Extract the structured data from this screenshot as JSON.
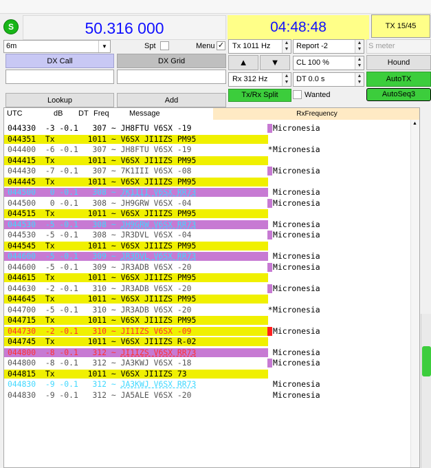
{
  "toolbar": {
    "band_menu_icon": "S"
  },
  "header": {
    "frequency": "50.316 000",
    "clock": "04:48:48",
    "tx_counter": "TX 15/45"
  },
  "controls": {
    "band": "6m",
    "spot_label": "Spt",
    "menu_label": "Menu",
    "tx_freq": "Tx  1011  Hz",
    "rx_freq": "Rx  312  Hz",
    "report": "Report -2",
    "s_meter_placeholder": "S meter",
    "cl": "CL  100 %",
    "dt": "DT 0.0 s",
    "dx_call_label": "DX Call",
    "dx_grid_label": "DX Grid",
    "lookup_label": "Lookup",
    "add_label": "Add",
    "txrx_split_label": "Tx/Rx Split",
    "wanted_label": "Wanted",
    "hound_label": "Hound",
    "autotx_label": "AutoTX",
    "autoseq_label": "AutoSeq3",
    "up_arrow": "▲",
    "down_arrow": "▼"
  },
  "decode_header": {
    "utc": "UTC",
    "db": "dB",
    "dt": "DT",
    "freq": "Freq",
    "message": "Message",
    "rx_frequency": "RxFrequency"
  },
  "colors": {
    "tx_yellow": "#f0f000",
    "cq_magenta": "#c77ad3",
    "mine_red": "#ff2020",
    "cyan_text": "#40d8ff",
    "red_text": "#ff3030",
    "autotx_green": "#3ccd3c"
  },
  "decodes": [
    {
      "utc": "044330",
      "db": "-3",
      "dt": "-0.1",
      "freq": "307",
      "sep": "~",
      "msg": "JH8FTU V6SX -19",
      "country": "Micronesia",
      "style": "normal",
      "mark": "magenta"
    },
    {
      "utc": "044351",
      "db": "Tx",
      "dt": "",
      "freq": "1011",
      "sep": "~",
      "msg": "V6SX JI1IZS PM95",
      "country": "",
      "style": "tx"
    },
    {
      "utc": "044400",
      "db": "-6",
      "dt": "-0.1",
      "freq": "307",
      "sep": "~",
      "msg": "JH8FTU V6SX -19",
      "country": "Micronesia",
      "style": "gray",
      "mark": "star"
    },
    {
      "utc": "044415",
      "db": "Tx",
      "dt": "",
      "freq": "1011",
      "sep": "~",
      "msg": "V6SX JI1IZS PM95",
      "country": "",
      "style": "tx"
    },
    {
      "utc": "044430",
      "db": "-7",
      "dt": "-0.1",
      "freq": "307",
      "sep": "~",
      "msg": "7K1III V6SX -08",
      "country": "Micronesia",
      "style": "gray",
      "mark": "magenta"
    },
    {
      "utc": "044445",
      "db": "Tx",
      "dt": "",
      "freq": "1011",
      "sep": "~",
      "msg": "V6SX JI1IZS PM95",
      "country": "",
      "style": "tx"
    },
    {
      "utc": "044500",
      "db": "0",
      "dt": "-0.1",
      "freq": "308",
      "sep": "~",
      "msg": "7K1III V6SX RR73",
      "country": "Micronesia",
      "style": "cq"
    },
    {
      "utc": "044500",
      "db": "0",
      "dt": "-0.1",
      "freq": "308",
      "sep": "~",
      "msg": "JH9GRW V6SX -04",
      "country": "Micronesia",
      "style": "gray",
      "mark": "magenta"
    },
    {
      "utc": "044515",
      "db": "Tx",
      "dt": "",
      "freq": "1011",
      "sep": "~",
      "msg": "V6SX JI1IZS PM95",
      "country": "",
      "style": "tx"
    },
    {
      "utc": "044530",
      "db": "-5",
      "dt": "-0.1",
      "freq": "308",
      "sep": "~",
      "msg": "JH9GRW V6SX RR73",
      "country": "Micronesia",
      "style": "cq"
    },
    {
      "utc": "044530",
      "db": "-5",
      "dt": "-0.1",
      "freq": "308",
      "sep": "~",
      "msg": "JR3DVL V6SX -04",
      "country": "Micronesia",
      "style": "gray",
      "mark": "magenta"
    },
    {
      "utc": "044545",
      "db": "Tx",
      "dt": "",
      "freq": "1011",
      "sep": "~",
      "msg": "V6SX JI1IZS PM95",
      "country": "",
      "style": "tx"
    },
    {
      "utc": "044600",
      "db": "-5",
      "dt": "-0.1",
      "freq": "309",
      "sep": "~",
      "msg": "JR3DVL V6SX RR73",
      "country": "Micronesia",
      "style": "cq"
    },
    {
      "utc": "044600",
      "db": "-5",
      "dt": "-0.1",
      "freq": "309",
      "sep": "~",
      "msg": "JR3ADB V6SX -20",
      "country": "Micronesia",
      "style": "gray",
      "mark": "magenta"
    },
    {
      "utc": "044615",
      "db": "Tx",
      "dt": "",
      "freq": "1011",
      "sep": "~",
      "msg": "V6SX JI1IZS PM95",
      "country": "",
      "style": "tx"
    },
    {
      "utc": "044630",
      "db": "-2",
      "dt": "-0.1",
      "freq": "310",
      "sep": "~",
      "msg": "JR3ADB V6SX -20",
      "country": "Micronesia",
      "style": "gray",
      "mark": "magenta"
    },
    {
      "utc": "044645",
      "db": "Tx",
      "dt": "",
      "freq": "1011",
      "sep": "~",
      "msg": "V6SX JI1IZS PM95",
      "country": "",
      "style": "tx"
    },
    {
      "utc": "044700",
      "db": "-5",
      "dt": "-0.1",
      "freq": "310",
      "sep": "~",
      "msg": "JR3ADB V6SX -20",
      "country": "Micronesia",
      "style": "gray",
      "mark": "star"
    },
    {
      "utc": "044715",
      "db": "Tx",
      "dt": "",
      "freq": "1011",
      "sep": "~",
      "msg": "V6SX JI1IZS PM95",
      "country": "",
      "style": "tx"
    },
    {
      "utc": "044730",
      "db": "-2",
      "dt": "-0.1",
      "freq": "310",
      "sep": "~",
      "msg": "JI1IZS V6SX -09",
      "country": "Micronesia",
      "style": "mine",
      "mark": "red"
    },
    {
      "utc": "044745",
      "db": "Tx",
      "dt": "",
      "freq": "1011",
      "sep": "~",
      "msg": "V6SX JI1IZS R-02",
      "country": "",
      "style": "tx"
    },
    {
      "utc": "044800",
      "db": "-8",
      "dt": "-0.1",
      "freq": "312",
      "sep": "~",
      "msg": "JI1IZS V6SX RR73",
      "country": "Micronesia",
      "style": "mine_cq"
    },
    {
      "utc": "044800",
      "db": "-8",
      "dt": "-0.1",
      "freq": "312",
      "sep": "~",
      "msg": "JA3KWJ V6SX -18",
      "country": "Micronesia",
      "style": "gray",
      "mark": "magenta"
    },
    {
      "utc": "044815",
      "db": "Tx",
      "dt": "",
      "freq": "1011",
      "sep": "~",
      "msg": "V6SX JI1IZS 73",
      "country": "",
      "style": "tx"
    },
    {
      "utc": "044830",
      "db": "-9",
      "dt": "-0.1",
      "freq": "312",
      "sep": "~",
      "msg": "JA3KWJ V6SX RR73",
      "country": "Micronesia",
      "style": "cyan"
    },
    {
      "utc": "044830",
      "db": "-9",
      "dt": "-0.1",
      "freq": "312",
      "sep": "~",
      "msg": "JA5ALE V6SX -20",
      "country": "Micronesia",
      "style": "gray"
    }
  ]
}
